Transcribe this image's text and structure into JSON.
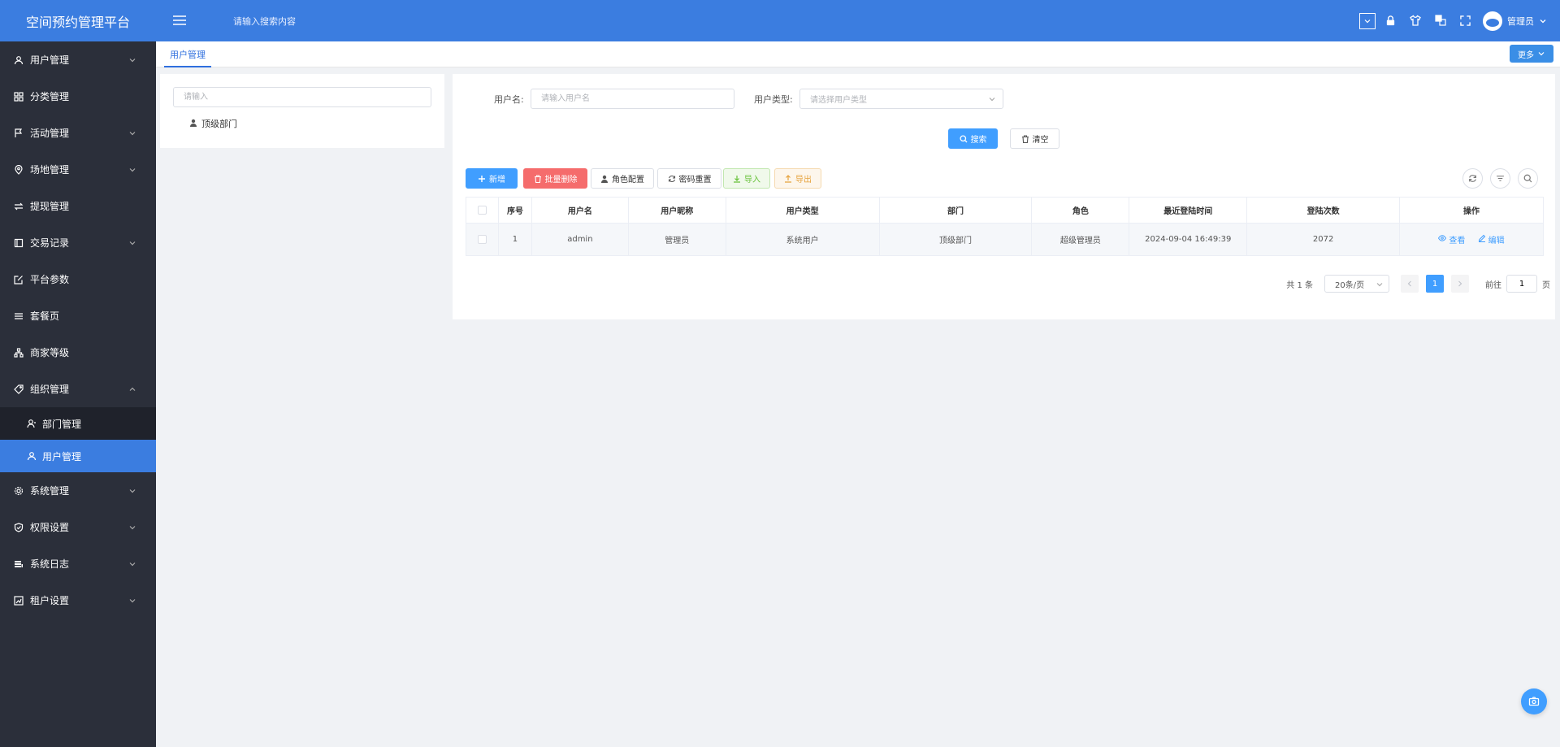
{
  "app": {
    "brand": "空间预约管理平台"
  },
  "header": {
    "search_placeholder": "请输入搜索内容",
    "user_name": "管理员"
  },
  "sidebar": {
    "items": [
      {
        "label": "用户管理",
        "icon": "user-manage-icon",
        "has_children": true
      },
      {
        "label": "分类管理",
        "icon": "grid-icon",
        "has_children": false
      },
      {
        "label": "活动管理",
        "icon": "flag-icon",
        "has_children": true
      },
      {
        "label": "场地管理",
        "icon": "location-icon",
        "has_children": true
      },
      {
        "label": "提现管理",
        "icon": "exchange-icon",
        "has_children": false
      },
      {
        "label": "交易记录",
        "icon": "record-icon",
        "has_children": true
      },
      {
        "label": "平台参数",
        "icon": "edit-icon",
        "has_children": false
      },
      {
        "label": "套餐页",
        "icon": "list-icon",
        "has_children": false
      },
      {
        "label": "商家等级",
        "icon": "org-chart-icon",
        "has_children": false
      },
      {
        "label": "组织管理",
        "icon": "tag-icon",
        "has_children": true,
        "expanded": true
      },
      {
        "label": "系统管理",
        "icon": "gear-icon",
        "has_children": true
      },
      {
        "label": "权限设置",
        "icon": "shield-icon",
        "has_children": true
      },
      {
        "label": "系统日志",
        "icon": "log-icon",
        "has_children": true
      },
      {
        "label": "租户设置",
        "icon": "tenant-icon",
        "has_children": true
      }
    ],
    "sub_items": [
      {
        "label": "部门管理",
        "icon": "department-icon"
      },
      {
        "label": "用户管理",
        "icon": "user-icon",
        "active": true
      }
    ]
  },
  "tabs": {
    "active": "用户管理",
    "more": "更多"
  },
  "tree": {
    "search_placeholder": "请输入",
    "root_node": "顶级部门"
  },
  "filter": {
    "username_label": "用户名:",
    "username_placeholder": "请输入用户名",
    "usertype_label": "用户类型:",
    "usertype_placeholder": "请选择用户类型",
    "search_btn": "搜索",
    "clear_btn": "清空"
  },
  "toolbar": {
    "add": "新增",
    "batch_delete": "批量删除",
    "role_config": "角色配置",
    "password_reset": "密码重置",
    "import": "导入",
    "export": "导出"
  },
  "table": {
    "columns": [
      "序号",
      "用户名",
      "用户昵称",
      "用户类型",
      "部门",
      "角色",
      "最近登陆时间",
      "登陆次数",
      "操作"
    ],
    "rows": [
      {
        "index": "1",
        "username": "admin",
        "nickname": "管理员",
        "type": "系统用户",
        "department": "顶级部门",
        "role": "超级管理员",
        "last_login": "2024-09-04 16:49:39",
        "login_count": "2072",
        "view": "查看",
        "edit": "编辑"
      }
    ]
  },
  "pagination": {
    "total": "共 1 条",
    "page_size": "20条/页",
    "current": "1",
    "goto_label": "前往",
    "goto_value": "1",
    "goto_suffix": "页"
  },
  "colors": {
    "primary": "#3b7de0",
    "sidebar_bg": "#2b2f3a",
    "button_primary": "#409eff",
    "danger": "#f56c6c"
  }
}
